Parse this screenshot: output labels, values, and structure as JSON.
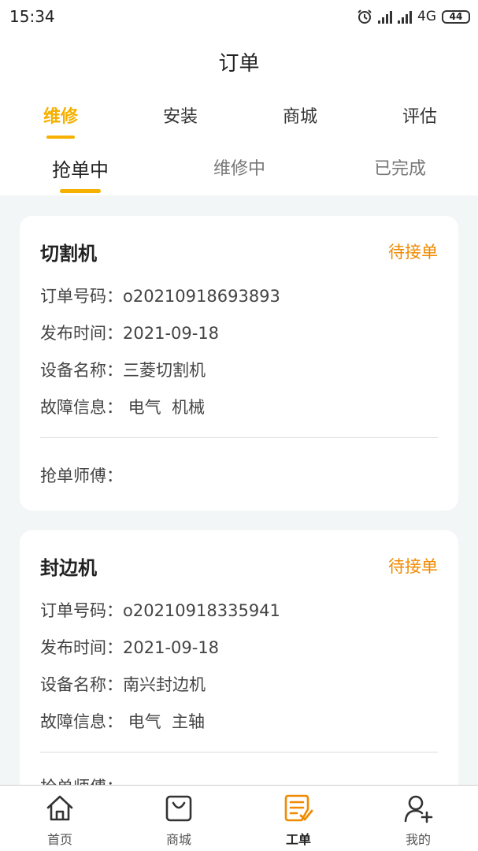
{
  "status_bar": {
    "time": "15:34",
    "network": "4G",
    "battery": "44"
  },
  "page": {
    "title": "订单"
  },
  "tabs": [
    {
      "label": "维修",
      "active": true
    },
    {
      "label": "安装",
      "active": false
    },
    {
      "label": "商城",
      "active": false
    },
    {
      "label": "评估",
      "active": false
    }
  ],
  "subtabs": [
    {
      "label": "抢单中",
      "active": true
    },
    {
      "label": "维修中",
      "active": false
    },
    {
      "label": "已完成",
      "active": false
    }
  ],
  "orders": [
    {
      "name": "切割机",
      "status": "待接单",
      "order_no_label": "订单号码：",
      "order_no": "o20210918693893",
      "publish_time_label": "发布时间：",
      "publish_time": "2021-09-18",
      "device_name_label": "设备名称：",
      "device_name": "三菱切割机",
      "fault_label": "故障信息：",
      "fault": " 电气  机械",
      "master_label": "抢单师傅："
    },
    {
      "name": "封边机",
      "status": "待接单",
      "order_no_label": "订单号码：",
      "order_no": "o20210918335941",
      "publish_time_label": "发布时间：",
      "publish_time": "2021-09-18",
      "device_name_label": "设备名称：",
      "device_name": "南兴封边机",
      "fault_label": "故障信息：",
      "fault": " 电气  主轴",
      "master_label": "抢单师傅："
    }
  ],
  "bottom_nav": [
    {
      "label": "首页",
      "icon": "home-icon",
      "active": false
    },
    {
      "label": "商城",
      "icon": "shopping-bag-icon",
      "active": false
    },
    {
      "label": "工单",
      "icon": "work-order-icon",
      "active": true
    },
    {
      "label": "我的",
      "icon": "add-user-icon",
      "active": false
    }
  ],
  "colors": {
    "accent": "#f5b000",
    "status": "#f08a00",
    "background": "#f3f6f6"
  }
}
